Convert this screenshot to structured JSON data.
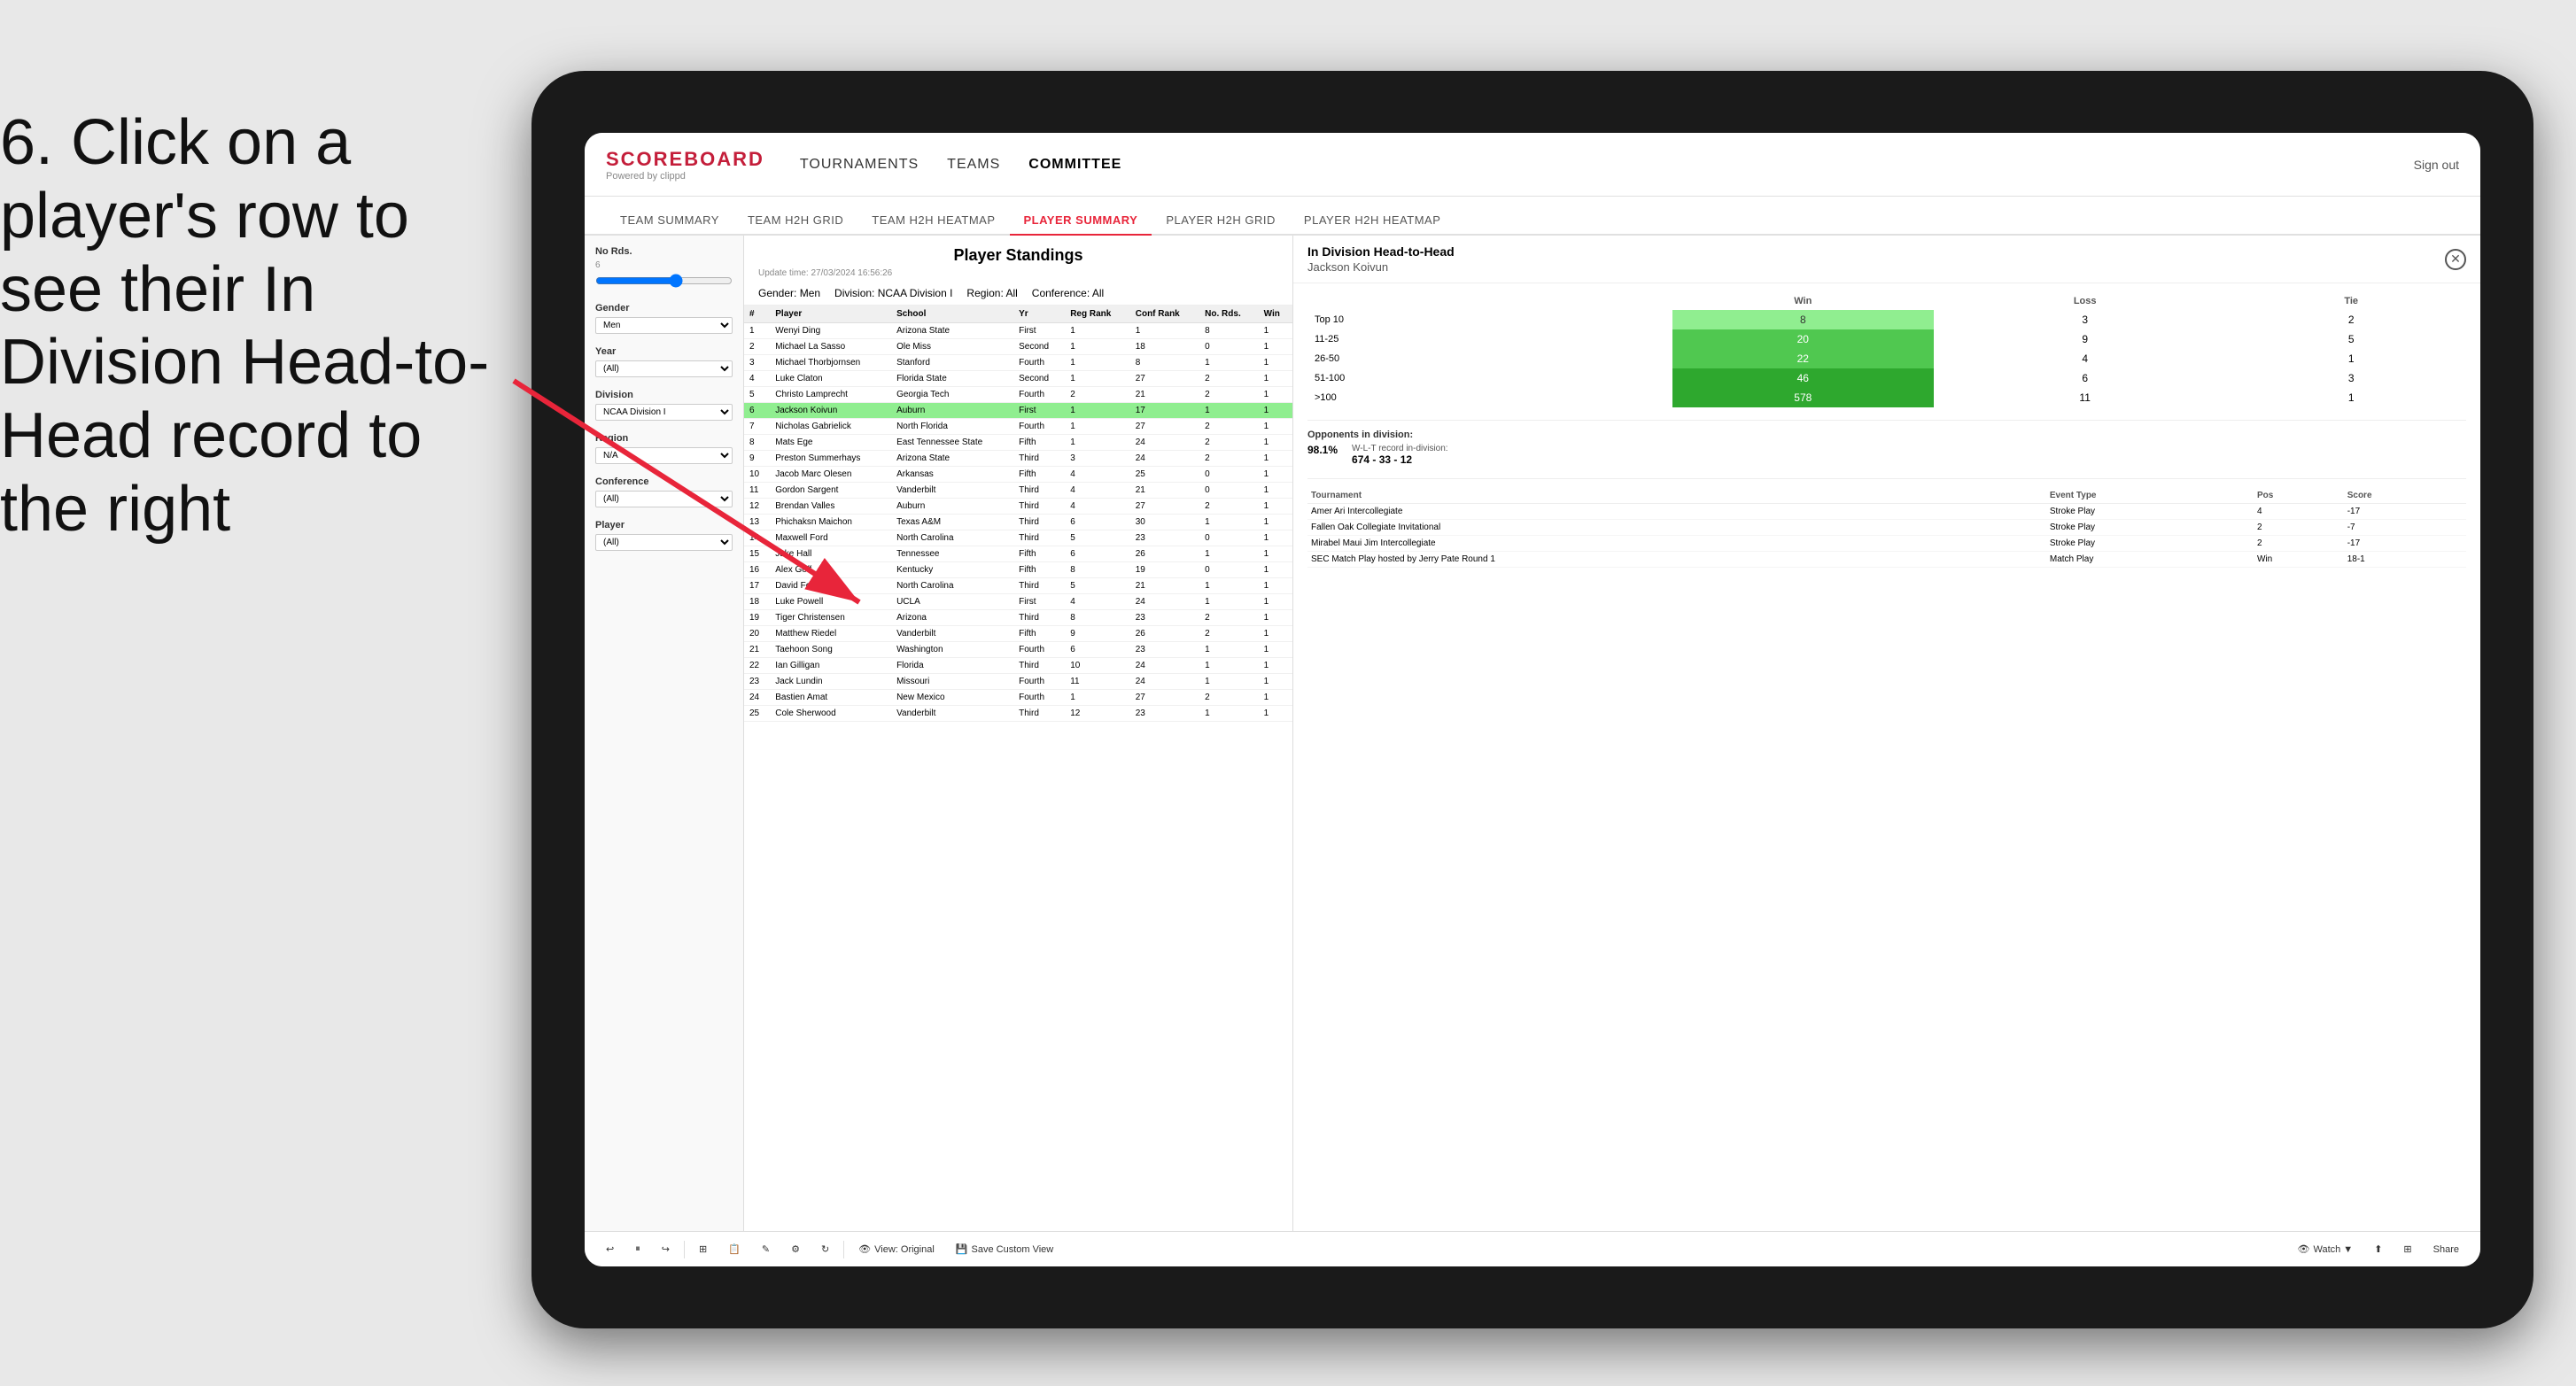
{
  "instruction": {
    "text": "6. Click on a player's row to see their In Division Head-to-Head record to the right"
  },
  "nav": {
    "logo": "SCOREBOARD",
    "logo_sub": "Powered by clippd",
    "links": [
      "TOURNAMENTS",
      "TEAMS",
      "COMMITTEE"
    ],
    "sign_out": "Sign out"
  },
  "sub_nav": {
    "items": [
      "TEAM SUMMARY",
      "TEAM H2H GRID",
      "TEAM H2H HEATMAP",
      "PLAYER SUMMARY",
      "PLAYER H2H GRID",
      "PLAYER H2H HEATMAP"
    ],
    "active": "PLAYER SUMMARY"
  },
  "panel": {
    "title": "Player Standings",
    "update_time": "Update time:",
    "update_value": "27/03/2024 16:56:26",
    "filters": {
      "gender": "Gender: Men",
      "division": "Division: NCAA Division I",
      "region": "Region: All",
      "conference": "Conference: All"
    }
  },
  "filters_panel": {
    "no_rds_label": "No Rds.",
    "no_rds_value": "6",
    "gender_label": "Gender",
    "gender_value": "Men",
    "year_label": "Year",
    "year_value": "(All)",
    "division_label": "Division",
    "division_value": "NCAA Division I",
    "region_label": "Region",
    "region_value": "N/A",
    "conference_label": "Conference",
    "conference_value": "(All)",
    "player_label": "Player",
    "player_value": "(All)"
  },
  "table": {
    "headers": [
      "#",
      "Player",
      "School",
      "Yr",
      "Reg Rank",
      "Conf Rank",
      "No. Rds.",
      "Win"
    ],
    "rows": [
      {
        "num": 1,
        "player": "Wenyi Ding",
        "school": "Arizona State",
        "yr": "First",
        "reg": 1,
        "conf": 1,
        "rds": 8,
        "win": 1,
        "selected": false
      },
      {
        "num": 2,
        "player": "Michael La Sasso",
        "school": "Ole Miss",
        "yr": "Second",
        "reg": 1,
        "conf": 18,
        "rds": 0,
        "win": 1,
        "selected": false
      },
      {
        "num": 3,
        "player": "Michael Thorbjornsen",
        "school": "Stanford",
        "yr": "Fourth",
        "reg": 1,
        "conf": 8,
        "rds": 1,
        "win": 1,
        "selected": false
      },
      {
        "num": 4,
        "player": "Luke Claton",
        "school": "Florida State",
        "yr": "Second",
        "reg": 1,
        "conf": 27,
        "rds": 2,
        "win": 1,
        "selected": false
      },
      {
        "num": 5,
        "player": "Christo Lamprecht",
        "school": "Georgia Tech",
        "yr": "Fourth",
        "reg": 2,
        "conf": 21,
        "rds": 2,
        "win": 1,
        "selected": false
      },
      {
        "num": 6,
        "player": "Jackson Koivun",
        "school": "Auburn",
        "yr": "First",
        "reg": 1,
        "conf": 17,
        "rds": 1,
        "win": 1,
        "selected": true
      },
      {
        "num": 7,
        "player": "Nicholas Gabrielick",
        "school": "North Florida",
        "yr": "Fourth",
        "reg": 1,
        "conf": 27,
        "rds": 2,
        "win": 1,
        "selected": false
      },
      {
        "num": 8,
        "player": "Mats Ege",
        "school": "East Tennessee State",
        "yr": "Fifth",
        "reg": 1,
        "conf": 24,
        "rds": 2,
        "win": 1,
        "selected": false
      },
      {
        "num": 9,
        "player": "Preston Summerhays",
        "school": "Arizona State",
        "yr": "Third",
        "reg": 3,
        "conf": 24,
        "rds": 2,
        "win": 1,
        "selected": false
      },
      {
        "num": 10,
        "player": "Jacob Marc Olesen",
        "school": "Arkansas",
        "yr": "Fifth",
        "reg": 4,
        "conf": 25,
        "rds": 0,
        "win": 1,
        "selected": false
      },
      {
        "num": 11,
        "player": "Gordon Sargent",
        "school": "Vanderbilt",
        "yr": "Third",
        "reg": 4,
        "conf": 21,
        "rds": 0,
        "win": 1,
        "selected": false
      },
      {
        "num": 12,
        "player": "Brendan Valles",
        "school": "Auburn",
        "yr": "Third",
        "reg": 4,
        "conf": 27,
        "rds": 2,
        "win": 1,
        "selected": false
      },
      {
        "num": 13,
        "player": "Phichaksn Maichon",
        "school": "Texas A&M",
        "yr": "Third",
        "reg": 6,
        "conf": 30,
        "rds": 1,
        "win": 1,
        "selected": false
      },
      {
        "num": 14,
        "player": "Maxwell Ford",
        "school": "North Carolina",
        "yr": "Third",
        "reg": 5,
        "conf": 23,
        "rds": 0,
        "win": 1,
        "selected": false
      },
      {
        "num": 15,
        "player": "Jake Hall",
        "school": "Tennessee",
        "yr": "Fifth",
        "reg": 6,
        "conf": 26,
        "rds": 1,
        "win": 1,
        "selected": false
      },
      {
        "num": 16,
        "player": "Alex Goff",
        "school": "Kentucky",
        "yr": "Fifth",
        "reg": 8,
        "conf": 19,
        "rds": 0,
        "win": 1,
        "selected": false
      },
      {
        "num": 17,
        "player": "David Ford",
        "school": "North Carolina",
        "yr": "Third",
        "reg": 5,
        "conf": 21,
        "rds": 1,
        "win": 1,
        "selected": false
      },
      {
        "num": 18,
        "player": "Luke Powell",
        "school": "UCLA",
        "yr": "First",
        "reg": 4,
        "conf": 24,
        "rds": 1,
        "win": 1,
        "selected": false
      },
      {
        "num": 19,
        "player": "Tiger Christensen",
        "school": "Arizona",
        "yr": "Third",
        "reg": 8,
        "conf": 23,
        "rds": 2,
        "win": 1,
        "selected": false
      },
      {
        "num": 20,
        "player": "Matthew Riedel",
        "school": "Vanderbilt",
        "yr": "Fifth",
        "reg": 9,
        "conf": 26,
        "rds": 2,
        "win": 1,
        "selected": false
      },
      {
        "num": 21,
        "player": "Taehoon Song",
        "school": "Washington",
        "yr": "Fourth",
        "reg": 6,
        "conf": 23,
        "rds": 1,
        "win": 1,
        "selected": false
      },
      {
        "num": 22,
        "player": "Ian Gilligan",
        "school": "Florida",
        "yr": "Third",
        "reg": 10,
        "conf": 24,
        "rds": 1,
        "win": 1,
        "selected": false
      },
      {
        "num": 23,
        "player": "Jack Lundin",
        "school": "Missouri",
        "yr": "Fourth",
        "reg": 11,
        "conf": 24,
        "rds": 1,
        "win": 1,
        "selected": false
      },
      {
        "num": 24,
        "player": "Bastien Amat",
        "school": "New Mexico",
        "yr": "Fourth",
        "reg": 1,
        "conf": 27,
        "rds": 2,
        "win": 1,
        "selected": false
      },
      {
        "num": 25,
        "player": "Cole Sherwood",
        "school": "Vanderbilt",
        "yr": "Third",
        "reg": 12,
        "conf": 23,
        "rds": 1,
        "win": 1,
        "selected": false
      }
    ]
  },
  "h2h": {
    "title": "In Division Head-to-Head",
    "player_name": "Jackson Koivun",
    "table": {
      "headers": [
        "",
        "Win",
        "Loss",
        "Tie"
      ],
      "rows": [
        {
          "label": "Top 10",
          "win": 8,
          "loss": 3,
          "tie": 2,
          "win_color": "light"
        },
        {
          "label": "11-25",
          "win": 20,
          "loss": 9,
          "tie": 5,
          "win_color": "mid"
        },
        {
          "label": "26-50",
          "win": 22,
          "loss": 4,
          "tie": 1,
          "win_color": "mid"
        },
        {
          "label": "51-100",
          "win": 46,
          "loss": 6,
          "tie": 3,
          "win_color": "dark"
        },
        {
          "label": ">100",
          "win": 578,
          "loss": 11,
          "tie": 1,
          "win_color": "dark"
        }
      ]
    },
    "opponents_label": "Opponents in division:",
    "wlt_label": "W-L-T record in-division:",
    "opponents_pct": "98.1%",
    "wlt_record": "674 - 33 - 12",
    "tournament_headers": [
      "Tournament",
      "Event Type",
      "Pos",
      "Score"
    ],
    "tournaments": [
      {
        "name": "Amer Ari Intercollegiate",
        "type": "Stroke Play",
        "pos": 4,
        "score": "-17"
      },
      {
        "name": "Fallen Oak Collegiate Invitational",
        "type": "Stroke Play",
        "pos": 2,
        "score": "-7"
      },
      {
        "name": "Mirabel Maui Jim Intercollegiate",
        "type": "Stroke Play",
        "pos": 2,
        "score": "-17"
      },
      {
        "name": "SEC Match Play hosted by Jerry Pate Round 1",
        "type": "Match Play",
        "pos": "Win",
        "score": "18-1"
      }
    ]
  },
  "toolbar": {
    "view_label": "View: Original",
    "save_label": "Save Custom View",
    "watch_label": "Watch ▼",
    "share_label": "Share"
  }
}
